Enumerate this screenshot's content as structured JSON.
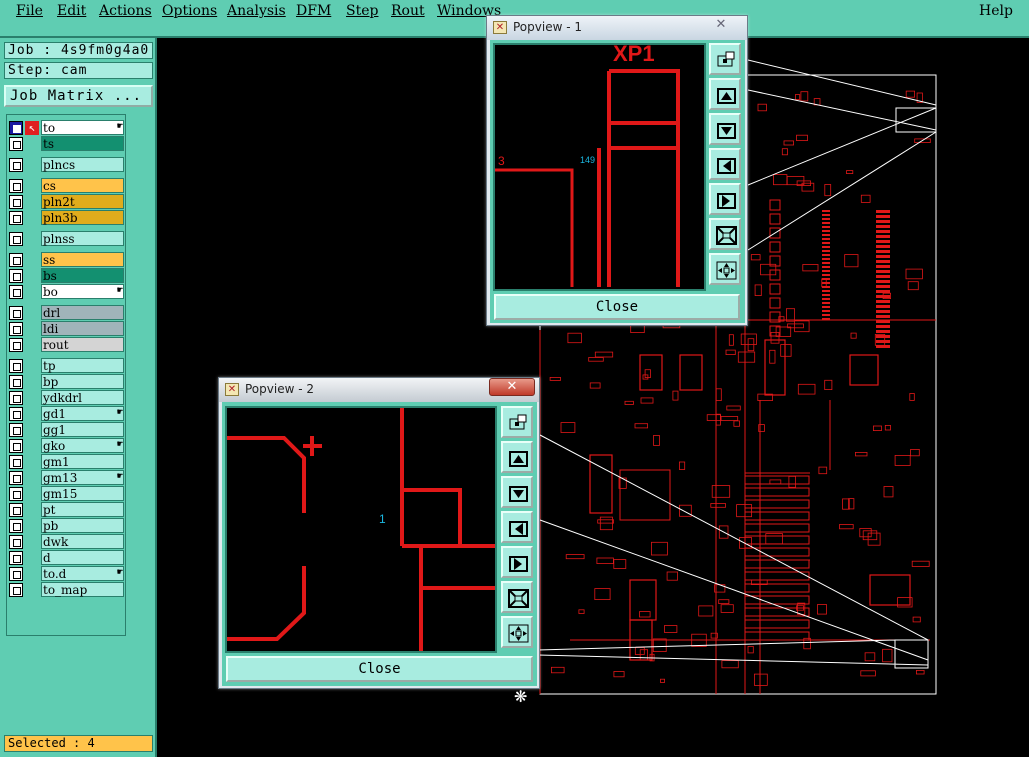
{
  "menu": {
    "items": [
      "File",
      "Edit",
      "Actions",
      "Options",
      "Analysis",
      "DFM",
      "Step",
      "Rout",
      "Windows"
    ],
    "help": "Help"
  },
  "job": {
    "job_label": "Job : 4s9fm0g4a0",
    "step_label": "Step: cam",
    "matrix_button": "Job Matrix ..."
  },
  "layers": [
    {
      "name": "to",
      "color": "white",
      "hand": true,
      "active": true
    },
    {
      "name": "ts",
      "color": "teal"
    },
    {
      "name": "plncs",
      "color": "cyan"
    },
    {
      "name": "cs",
      "color": "orange"
    },
    {
      "name": "pln2t",
      "color": "gold"
    },
    {
      "name": "pln3b",
      "color": "gold"
    },
    {
      "name": "plnss",
      "color": "cyan"
    },
    {
      "name": "ss",
      "color": "orange"
    },
    {
      "name": "bs",
      "color": "teal"
    },
    {
      "name": "bo",
      "color": "white",
      "hand": true
    },
    {
      "name": "drl",
      "color": "gray"
    },
    {
      "name": "ldi",
      "color": "gray"
    },
    {
      "name": "rout",
      "color": "lgray"
    },
    {
      "name": "tp",
      "color": "cyan"
    },
    {
      "name": "bp",
      "color": "cyan"
    },
    {
      "name": "ydkdrl",
      "color": "cyan"
    },
    {
      "name": "gd1",
      "color": "cyan",
      "hand": true
    },
    {
      "name": "gg1",
      "color": "cyan"
    },
    {
      "name": "gko",
      "color": "cyan",
      "hand": true
    },
    {
      "name": "gm1",
      "color": "cyan"
    },
    {
      "name": "gm13",
      "color": "cyan",
      "hand": true
    },
    {
      "name": "gm15",
      "color": "cyan"
    },
    {
      "name": "pt",
      "color": "cyan"
    },
    {
      "name": "pb",
      "color": "cyan"
    },
    {
      "name": "dwk",
      "color": "cyan"
    },
    {
      "name": "d",
      "color": "cyan"
    },
    {
      "name": "to.d",
      "color": "cyan",
      "hand": true
    },
    {
      "name": "to_map",
      "color": "cyan"
    }
  ],
  "status": {
    "selected": "Selected : 4"
  },
  "popview1": {
    "title": "Popview - 1",
    "close_label": "Close",
    "ref_label": "XP1",
    "pad_label": "3",
    "net_label": "149",
    "closex": "✕"
  },
  "popview2": {
    "title": "Popview - 2",
    "close_label": "Close",
    "net_label": "1",
    "closex": "✕"
  },
  "colors": {
    "panel": "#5fcdb2",
    "trace": "#e01818",
    "canvas": "#000000",
    "net_text": "#1bb7e0"
  }
}
